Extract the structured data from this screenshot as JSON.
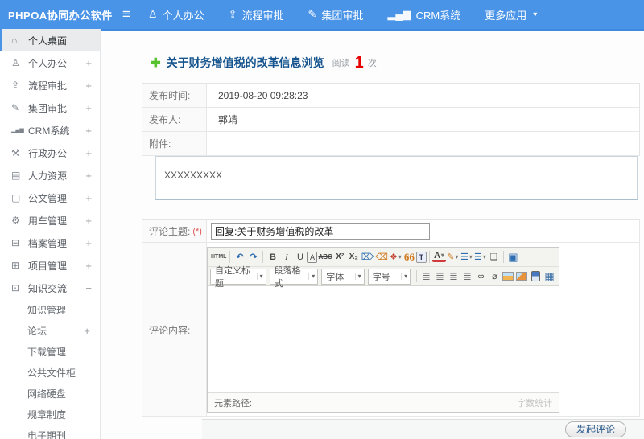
{
  "app": {
    "title": "PHPOA协同办公软件"
  },
  "topnav": {
    "menu_glyph": "≡",
    "items": [
      {
        "icon": "user-icon",
        "glyph": "♙",
        "label": "个人办公"
      },
      {
        "icon": "workflow-icon",
        "glyph": "⇪",
        "label": "流程审批"
      },
      {
        "icon": "edit-icon",
        "glyph": "✎",
        "label": "集团审批"
      },
      {
        "icon": "chart-icon",
        "glyph": "▂▄▆",
        "label": "CRM系统"
      },
      {
        "icon": "more-apps",
        "glyph": "",
        "label": "更多应用",
        "arrow": "▾"
      }
    ]
  },
  "sidebar": {
    "items": [
      {
        "icon": "home-icon",
        "glyph": "⌂",
        "label": "个人桌面",
        "expander": ""
      },
      {
        "icon": "user-icon",
        "glyph": "♙",
        "label": "个人办公",
        "expander": "+"
      },
      {
        "icon": "workflow-icon",
        "glyph": "⇪",
        "label": "流程审批",
        "expander": "+"
      },
      {
        "icon": "edit-icon",
        "glyph": "✎",
        "label": "集团审批",
        "expander": "+"
      },
      {
        "icon": "chart-icon",
        "glyph": "▂▄▆",
        "label": "CRM系统",
        "expander": "+"
      },
      {
        "icon": "briefcase-icon",
        "glyph": "⚒",
        "label": "行政办公",
        "expander": "+"
      },
      {
        "icon": "book-icon",
        "glyph": "▤",
        "label": "人力资源",
        "expander": "+"
      },
      {
        "icon": "document-icon",
        "glyph": "▢",
        "label": "公文管理",
        "expander": "+"
      },
      {
        "icon": "car-icon",
        "glyph": "⚙",
        "label": "用车管理",
        "expander": "+"
      },
      {
        "icon": "archive-icon",
        "glyph": "⊟",
        "label": "档案管理",
        "expander": "+"
      },
      {
        "icon": "project-icon",
        "glyph": "⊞",
        "label": "项目管理",
        "expander": "+"
      },
      {
        "icon": "knowledge-icon",
        "glyph": "⊡",
        "label": "知识交流",
        "expander": "−"
      }
    ],
    "subitems": [
      {
        "label": "知识管理",
        "expander": ""
      },
      {
        "label": "论坛",
        "expander": "+"
      },
      {
        "label": "下载管理",
        "expander": ""
      },
      {
        "label": "公共文件柜",
        "expander": ""
      },
      {
        "label": "网络硬盘",
        "expander": ""
      },
      {
        "label": "规章制度",
        "expander": ""
      },
      {
        "label": "电子期刊",
        "expander": ""
      }
    ]
  },
  "page": {
    "title_plus_glyph": "✚",
    "title": "关于财务增值税的改革信息浏览",
    "read_label": "阅读",
    "read_count": "1",
    "read_unit": "次"
  },
  "info": {
    "rows": [
      {
        "label": "发布时间:",
        "value": "2019-08-20 09:28:23"
      },
      {
        "label": "发布人:",
        "value": "郭靖"
      },
      {
        "label": "附件:",
        "value": ""
      }
    ],
    "content": "XXXXXXXXX"
  },
  "comment": {
    "subject_label": "评论主题:",
    "required_mark": "(*)",
    "subject_value": "回复:关于财务增值税的改革",
    "content_label": "评论内容:"
  },
  "editor": {
    "small_arrow": "▾",
    "toolbar1": [
      {
        "name": "source-code-icon",
        "glyph": "HTML"
      },
      {
        "name": "undo-icon",
        "glyph": "↶"
      },
      {
        "name": "redo-icon",
        "glyph": "↷"
      },
      {
        "name": "bold-icon",
        "glyph": "B"
      },
      {
        "name": "italic-icon",
        "glyph": "I"
      },
      {
        "name": "underline-icon",
        "glyph": "U"
      },
      {
        "name": "font-style-icon",
        "glyph": "A"
      },
      {
        "name": "strikethrough-icon",
        "glyph": "ABC"
      },
      {
        "name": "superscript-icon",
        "glyph": "X²"
      },
      {
        "name": "subscript-icon",
        "glyph": "X₂"
      },
      {
        "name": "eraser-icon",
        "glyph": "⌦"
      },
      {
        "name": "remove-format-icon",
        "glyph": "⌫"
      },
      {
        "name": "color-palette-icon",
        "glyph": "❖"
      },
      {
        "name": "quote-icon",
        "glyph": "66"
      },
      {
        "name": "paste-text-icon",
        "glyph": "T"
      },
      {
        "name": "font-color-icon",
        "glyph": "A"
      },
      {
        "name": "highlight-color-icon",
        "glyph": "✎"
      },
      {
        "name": "ordered-list-icon",
        "glyph": "☰"
      },
      {
        "name": "unordered-list-icon",
        "glyph": "☰"
      },
      {
        "name": "new-document-icon",
        "glyph": "❏"
      },
      {
        "name": "fullscreen-icon",
        "glyph": "▣"
      }
    ],
    "dropdowns": [
      {
        "label": "自定义标题"
      },
      {
        "label": "段落格式"
      },
      {
        "label": "字体"
      },
      {
        "label": "字号"
      }
    ],
    "toolbar2": [
      {
        "name": "align-left-icon",
        "glyph": "≣"
      },
      {
        "name": "align-center-icon",
        "glyph": "≣"
      },
      {
        "name": "align-right-icon",
        "glyph": "≣"
      },
      {
        "name": "align-justify-icon",
        "glyph": "≣"
      },
      {
        "name": "link-icon",
        "glyph": "∞"
      },
      {
        "name": "unlink-icon",
        "glyph": "⌀"
      },
      {
        "name": "table-icon",
        "glyph": "▦"
      }
    ],
    "statusbar": {
      "left": "元素路径:",
      "right": "字数统计"
    }
  },
  "footer": {
    "submit_label": "发起评论"
  },
  "colors": {
    "topbar": "#4a94e8",
    "accent_blue": "#3f8ade",
    "title_blue": "#15548e",
    "read_red": "#e60000",
    "plus_green": "#57c12e"
  }
}
